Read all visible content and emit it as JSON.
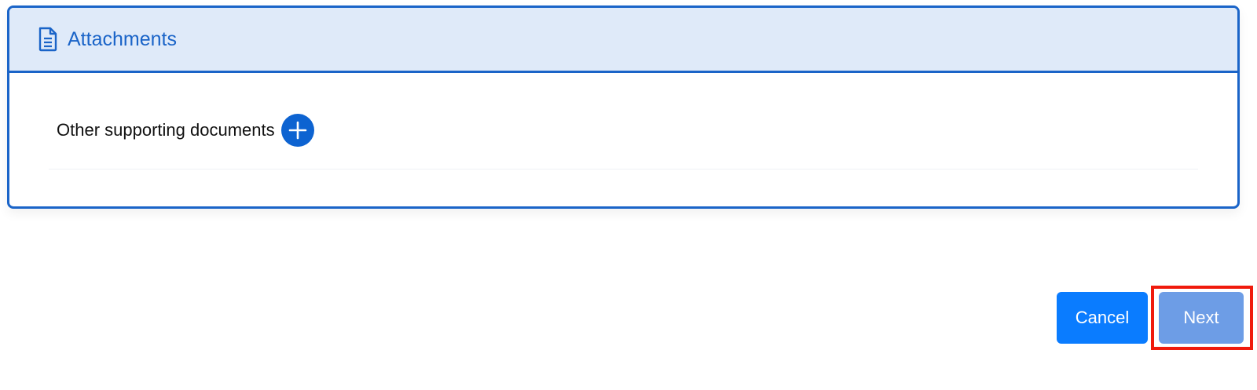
{
  "section": {
    "title": "Attachments",
    "icon": "document-icon",
    "accent_color": "#1a64c8",
    "header_background": "#dfeaf9"
  },
  "attachments": {
    "row_label": "Other supporting documents",
    "add_icon": "plus-circle-icon"
  },
  "actions": {
    "cancel_label": "Cancel",
    "next_label": "Next",
    "cancel_color": "#0a7cff",
    "next_color": "#6d9de6",
    "highlight_color": "#f01a0c"
  }
}
